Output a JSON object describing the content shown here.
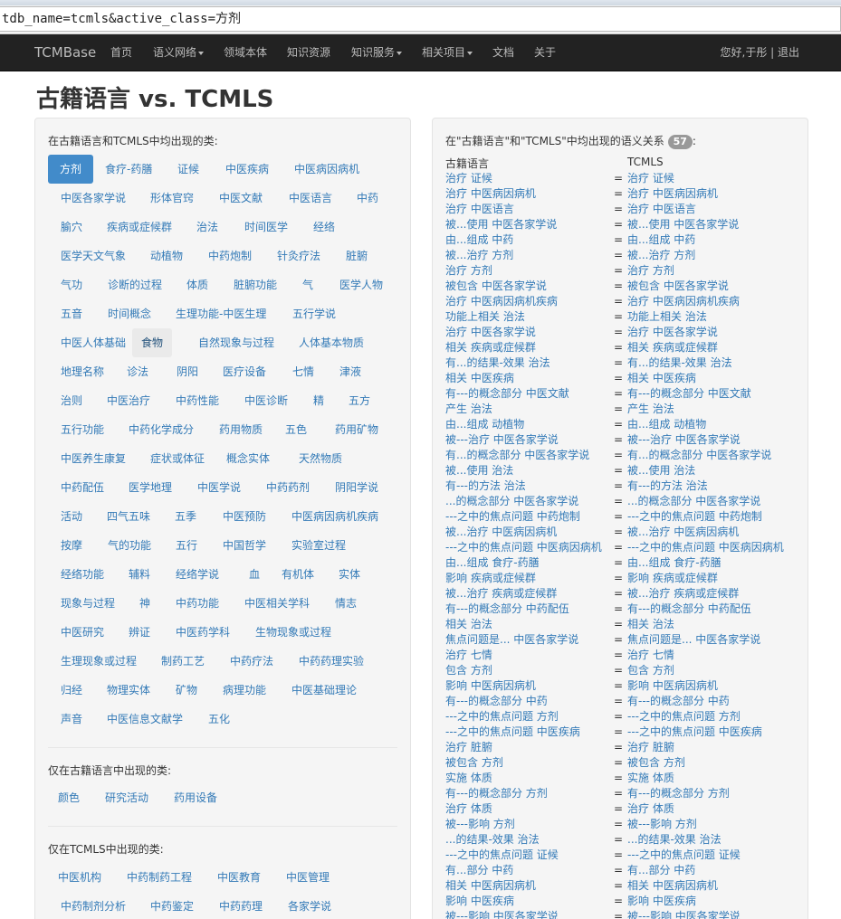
{
  "browser": {
    "url": "tdb_name=tcmls&active_class=方剂"
  },
  "navbar": {
    "brand": "TCMBase",
    "items": [
      "首页",
      "语义网络",
      "领域本体",
      "知识资源",
      "知识服务",
      "相关项目",
      "文档",
      "关于"
    ],
    "user": "您好,于彤 | 退出"
  },
  "page": {
    "title": "古籍语言 vs. TCMLS"
  },
  "common": {
    "label": "在古籍语言和TCMLS中均出现的类:",
    "rows": [
      [
        "方剂",
        "食疗-药膳",
        "证候",
        "中医疾病",
        "中医病因病机"
      ],
      [
        "中医各家学说",
        "形体官窍",
        "中医文献",
        "中医语言",
        "中药"
      ],
      [
        "腧穴",
        "疾病或症候群",
        "治法",
        "时间医学",
        "经络"
      ],
      [
        "医学天文气象",
        "动植物",
        "中药炮制",
        "针灸疗法",
        "脏腑"
      ],
      [
        "气功",
        "诊断的过程",
        "体质",
        "脏腑功能",
        "气",
        "医学人物"
      ],
      [
        "五音",
        "时间概念",
        "生理功能-中医生理",
        "五行学说"
      ],
      [
        "中医人体基础",
        "食物",
        "自然现象与过程",
        "人体基本物质"
      ],
      [
        "地理名称",
        "诊法",
        "阴阳",
        "医疗设备",
        "七情",
        "津液"
      ],
      [
        "治则",
        "中医治疗",
        "中药性能",
        "中医诊断",
        "精",
        "五方"
      ],
      [
        "五行功能",
        "中药化学成分",
        "药用物质",
        "五色",
        "药用矿物"
      ],
      [
        "中医养生康复",
        "症状或体征",
        "概念实体",
        "天然物质"
      ],
      [
        "中药配伍",
        "医学地理",
        "中医学说",
        "中药药剂",
        "阴阳学说"
      ],
      [
        "活动",
        "四气五味",
        "五季",
        "中医预防",
        "中医病因病机疾病"
      ],
      [
        "按摩",
        "气的功能",
        "五行",
        "中国哲学",
        "实验室过程"
      ],
      [
        "经络功能",
        "辅料",
        "经络学说",
        "血",
        "有机体",
        "实体"
      ],
      [
        "现象与过程",
        "神",
        "中药功能",
        "中医相关学科",
        "情志"
      ],
      [
        "中医研究",
        "辨证",
        "中医药学科",
        "生物现象或过程"
      ],
      [
        "生理现象或过程",
        "制药工艺",
        "中药疗法",
        "中药药理实验"
      ],
      [
        "归经",
        "物理实体",
        "矿物",
        "病理功能",
        "中医基础理论"
      ],
      [
        "声音",
        "中医信息文献学",
        "五化"
      ]
    ]
  },
  "only_gj": {
    "label": "仅在古籍语言中出现的类:",
    "items": [
      "颜色",
      "研究活动",
      "药用设备"
    ]
  },
  "only_tcmls": {
    "label": "仅在TCMLS中出现的类:",
    "rows": [
      [
        "中医机构",
        "中药制药工程",
        "中医教育",
        "中医管理"
      ],
      [
        "中药制剂分析",
        "中药鉴定",
        "中药药理",
        "各家学说"
      ]
    ]
  },
  "relations": {
    "head_prefix": "在\"古籍语言\"和\"TCMLS\"中均出现的语义关系",
    "count": "57",
    "head_suffix": ":",
    "col_left": "古籍语言",
    "col_right": "TCMLS",
    "eq": "=",
    "rows": [
      "治疗 证候",
      "治疗 中医病因病机",
      "治疗 中医语言",
      "被...使用 中医各家学说",
      "由...组成 中药",
      "被...治疗 方剂",
      "治疗 方剂",
      "被包含 中医各家学说",
      "治疗 中医病因病机疾病",
      "功能上相关 治法",
      "治疗 中医各家学说",
      "相关 疾病或症候群",
      "有...的结果-效果 治法",
      "相关 中医疾病",
      "有---的概念部分 中医文献",
      "产生 治法",
      "由...组成 动植物",
      "被---治疗 中医各家学说",
      "有...的概念部分 中医各家学说",
      "被...使用 治法",
      "有---的方法 治法",
      "...的概念部分 中医各家学说",
      "---之中的焦点问题 中药炮制",
      "被...治疗 中医病因病机",
      "---之中的焦点问题 中医病因病机",
      "由...组成 食疗-药膳",
      "影响 疾病或症候群",
      "被...治疗 疾病或症候群",
      "有---的概念部分 中药配伍",
      "相关 治法",
      "焦点问题是... 中医各家学说",
      "治疗 七情",
      "包含 方剂",
      "影响 中医病因病机",
      "有---的概念部分 中药",
      "---之中的焦点问题 方剂",
      "---之中的焦点问题 中医疾病",
      "治疗 脏腑",
      "被包含 方剂",
      "实施 体质",
      "有---的概念部分 方剂",
      "治疗 体质",
      "被---影响 方剂",
      "...的结果-效果 治法",
      "---之中的焦点问题 证候",
      "有...部分 中药",
      "相关 中医病因病机",
      "影响 中医疾病",
      "被---影响 中医各家学说"
    ]
  }
}
